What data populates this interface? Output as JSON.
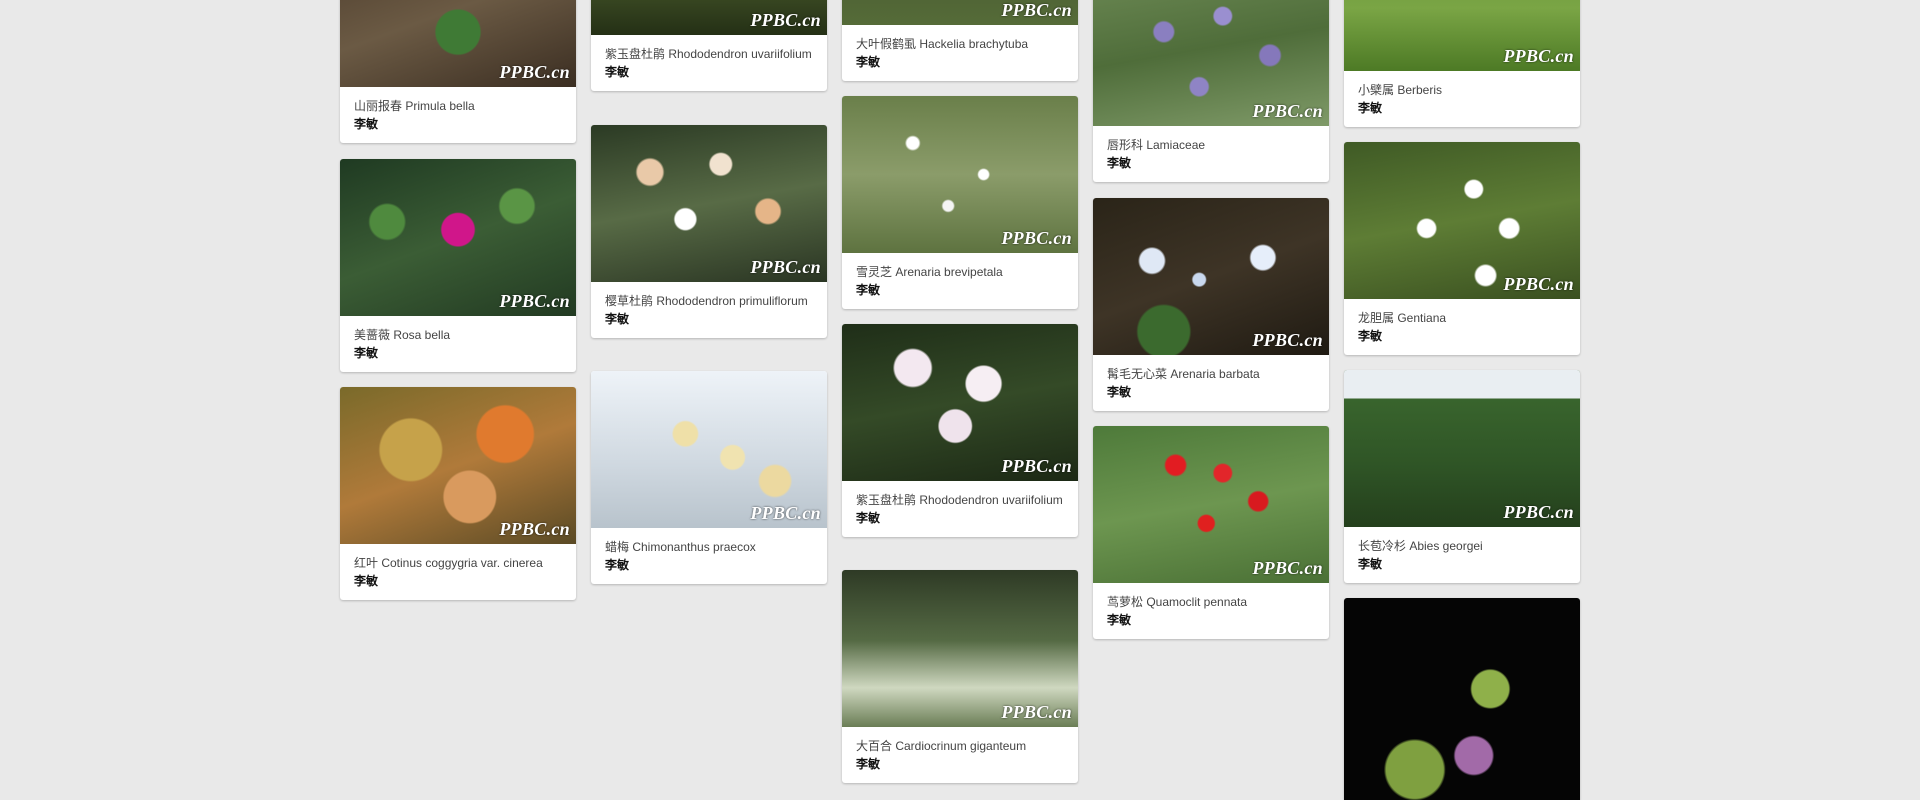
{
  "watermark": "PPBC.cn",
  "cards": [
    {
      "title": "山丽报春 Primula bella",
      "author": "李敏"
    },
    {
      "title": "紫玉盘杜鹃 Rhododendron uvariifolium",
      "author": "李敏"
    },
    {
      "title": "大叶假鹤虱 Hackelia brachytuba",
      "author": "李敏"
    },
    {
      "title": "唇形科 Lamiaceae",
      "author": "李敏"
    },
    {
      "title": "小檗属 Berberis",
      "author": "李敏"
    },
    {
      "title": "美蔷薇 Rosa bella",
      "author": "李敏"
    },
    {
      "title": "樱草杜鹃 Rhododendron primuliflorum",
      "author": "李敏"
    },
    {
      "title": "雪灵芝 Arenaria brevipetala",
      "author": "李敏"
    },
    {
      "title": "髯毛无心菜 Arenaria barbata",
      "author": "李敏"
    },
    {
      "title": "龙胆属 Gentiana",
      "author": "李敏"
    },
    {
      "title": "红叶 Cotinus coggygria var. cinerea",
      "author": "李敏"
    },
    {
      "title": "蜡梅 Chimonanthus praecox",
      "author": "李敏"
    },
    {
      "title": "紫玉盘杜鹃 Rhododendron uvariifolium",
      "author": "李敏"
    },
    {
      "title": "茑萝松 Quamoclit pennata",
      "author": "李敏"
    },
    {
      "title": "长苞冷杉 Abies georgei",
      "author": "李敏"
    },
    {
      "title": "大百合 Cardiocrinum giganteum",
      "author": "李敏"
    },
    {
      "title": "",
      "author": ""
    }
  ]
}
